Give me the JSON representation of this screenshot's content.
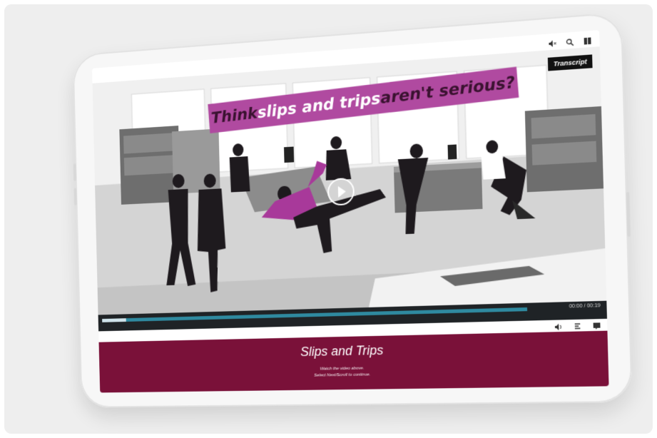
{
  "banner": {
    "part1": "Think",
    "part2": " slips and trips",
    "part3": " aren't serious?"
  },
  "video": {
    "transcript_label": "Transcript",
    "progress": 0.06,
    "time": "00:00 / 00:19"
  },
  "caption": {
    "title": "Slips and Trips",
    "line1": "Watch the video above.",
    "line2": "Select Next/Scroll to continue."
  },
  "icons": {
    "top": [
      "mute-icon",
      "search-icon",
      "menu-icon"
    ],
    "bottom": [
      "volume-icon",
      "captions-icon",
      "fullscreen-icon"
    ]
  },
  "colors": {
    "accent": "#b04aa0",
    "caption_bg": "#7a1139",
    "progress": "#2f8aa0"
  }
}
